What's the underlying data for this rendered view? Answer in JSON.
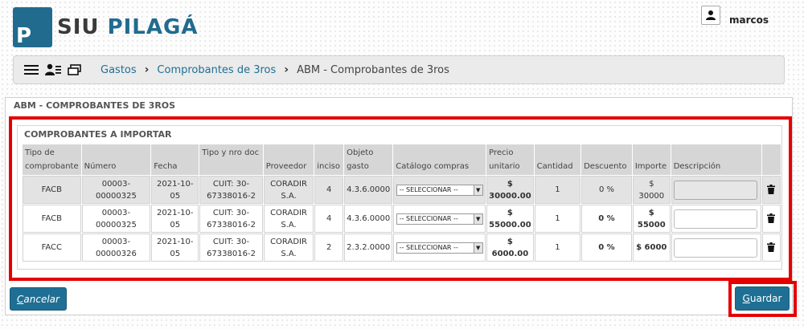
{
  "app": {
    "logo_letter": "P",
    "logo_prefix": "SIU ",
    "logo_name": "PILAGÁ"
  },
  "user": {
    "name": "marcos"
  },
  "breadcrumb": {
    "items": [
      "Gastos",
      "Comprobantes de 3ros"
    ],
    "current": "ABM - Comprobantes de 3ros"
  },
  "panel": {
    "title": "ABM - COMPROBANTES DE 3ROS"
  },
  "section": {
    "title": "COMPROBANTES A IMPORTAR"
  },
  "table": {
    "headers": {
      "tipo": "Tipo de comprobante",
      "numero": "Número",
      "fecha": "Fecha",
      "tipo_doc": "Tipo y nro doc",
      "proveedor": "Proveedor",
      "inciso": "inciso",
      "objeto": "Objeto gasto",
      "catalogo": "Catálogo compras",
      "precio": "Precio unitario",
      "cantidad": "Cantidad",
      "descuento": "Descuento",
      "importe": "Importe",
      "descripcion": "Descripción"
    },
    "rows": [
      {
        "tipo": "FACB",
        "numero": "00003-00000325",
        "fecha": "2021-10-05",
        "doc": "CUIT: 30-67338016-2",
        "proveedor": "CORADIR S.A.",
        "inciso": "4",
        "objeto": "4.3.6.0000",
        "catalogo": "-- SELECCIONAR --",
        "precio": "$ 30000.00",
        "cantidad": "1",
        "descuento": "0 %",
        "importe": "$ 30000",
        "descripcion": ""
      },
      {
        "tipo": "FACB",
        "numero": "00003-00000325",
        "fecha": "2021-10-05",
        "doc": "CUIT: 30-67338016-2",
        "proveedor": "CORADIR S.A.",
        "inciso": "4",
        "objeto": "4.3.6.0000",
        "catalogo": "-- SELECCIONAR --",
        "precio": "$ 55000.00",
        "cantidad": "1",
        "descuento": "0 %",
        "importe": "$ 55000",
        "descripcion": ""
      },
      {
        "tipo": "FACC",
        "numero": "00003-00000326",
        "fecha": "2021-10-05",
        "doc": "CUIT: 30-67338016-2",
        "proveedor": "CORADIR S.A.",
        "inciso": "2",
        "objeto": "2.3.2.0000",
        "catalogo": "-- SELECCIONAR --",
        "precio": "$ 6000.00",
        "cantidad": "1",
        "descuento": "0 %",
        "importe": "$ 6000",
        "descripcion": ""
      }
    ]
  },
  "buttons": {
    "cancel": "Cancelar",
    "save": "Guardar"
  },
  "colors": {
    "primary": "#1f6f94",
    "highlight": "#e50000"
  }
}
